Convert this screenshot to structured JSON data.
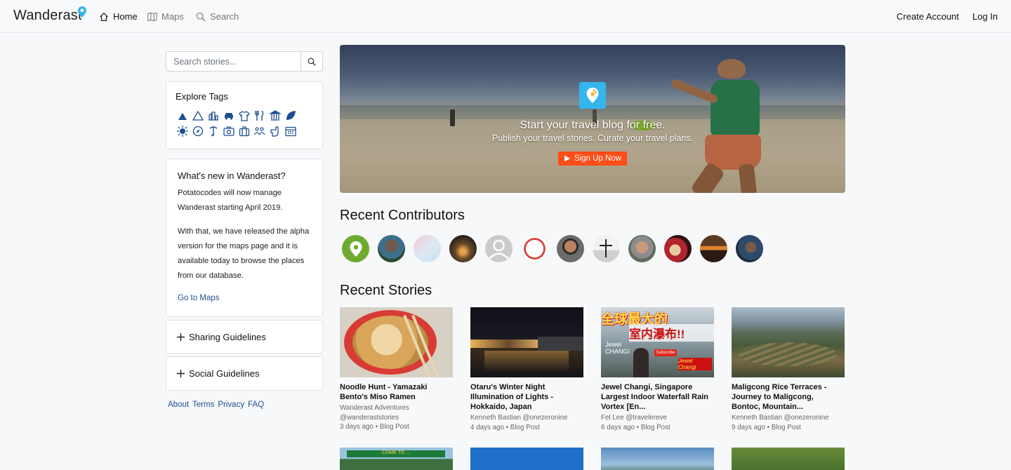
{
  "nav": {
    "brand": "Wanderast",
    "links": [
      {
        "label": "Home",
        "icon": "home-icon"
      },
      {
        "label": "Maps",
        "icon": "map-icon"
      },
      {
        "label": "Search",
        "icon": "search-icon"
      }
    ],
    "create_account": "Create Account",
    "login": "Log In"
  },
  "sidebar": {
    "search_placeholder": "Search stories...",
    "tags_title": "Explore Tags",
    "tag_icons": [
      "camping-icon",
      "mountain-icon",
      "city-icon",
      "car-icon",
      "shirt-icon",
      "food-icon",
      "museum-icon",
      "leaf-icon",
      "sun-icon",
      "compass-icon",
      "hiking-icon",
      "camera-icon",
      "luggage-icon",
      "people-icon",
      "hitchhike-icon",
      "calendar-icon"
    ],
    "news": {
      "title": "What's new in Wanderast?",
      "p1": "Potatocodes will now manage Wanderast starting April 2019.",
      "p2": "With that, we have released the alpha version for the maps page and it is available today to browse the places from our database.",
      "link": "Go to Maps"
    },
    "sharing": "Sharing Guidelines",
    "social": "Social Guidelines",
    "footer": [
      "About",
      "Terms",
      "Privacy",
      "FAQ"
    ]
  },
  "hero": {
    "title": "Start your travel blog for free.",
    "subtitle": "Publish your travel stories. Curate your travel plans.",
    "button": "Sign Up Now"
  },
  "contributors_title": "Recent Contributors",
  "stories_title": "Recent Stories",
  "stories": [
    {
      "title": "Noodle Hunt - Yamazaki Bento's Miso Ramen",
      "author": "Wanderast Adventures @wanderaststories",
      "meta": "3 days ago • Blog Post"
    },
    {
      "title": "Otaru's Winter Night Illumination of Lights - Hokkaido, Japan",
      "author": "Kenneth Bastian @onezeronine",
      "meta": "4 days ago • Blog Post"
    },
    {
      "title": "Jewel Changi, Singapore Largest Indoor Waterfall Rain Vortex [En...",
      "author": "Fel Lee @travelereve",
      "meta": "6 days ago • Blog Post"
    },
    {
      "title": "Maligcong Rice Terraces - Journey to Maligcong, Bontoc, Mountain...",
      "author": "Kenneth Bastian @onezeronine",
      "meta": "9 days ago • Blog Post"
    }
  ],
  "story_thumb_text": {
    "img3_line1": "全球最大的",
    "img3_line2": "室内瀑布!!",
    "img3_badge": "Subscribe",
    "img3_side": "Jewel CHANGI",
    "img3_note": "Jewel Changi",
    "img2_row2_sign": "COME TO ..."
  }
}
